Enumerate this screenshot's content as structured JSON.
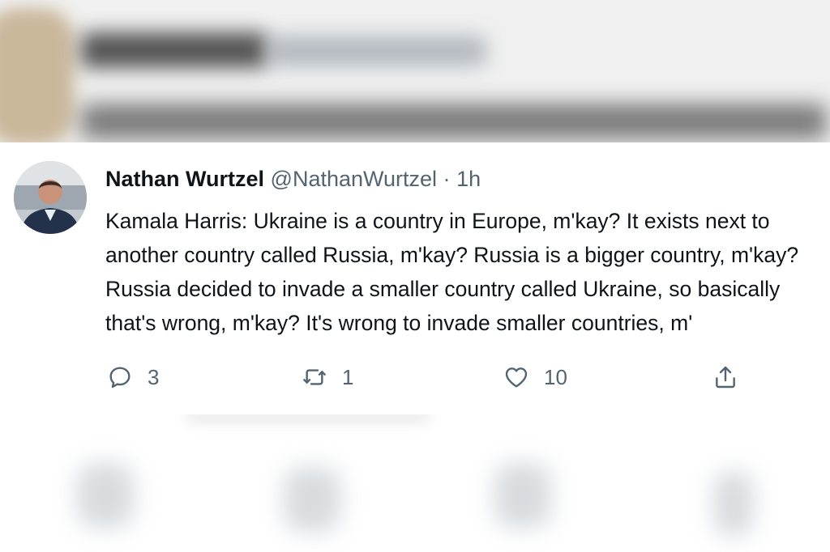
{
  "tweet": {
    "author_name": "Nathan Wurtzel",
    "handle": "@NathanWurtzel",
    "separator": "·",
    "time": "1h",
    "lines": [
      "Kamala Harris: Ukraine is a country in Europe, m'kay? It exists next to",
      "another country called Russia, m'kay? Russia is a bigger country, m'kay?",
      "Russia decided to invade a smaller country called Ukraine, so basically",
      "that's wrong, m'kay? It's wrong to invade smaller countries, m'"
    ]
  },
  "actions": {
    "reply": {
      "icon": "reply-icon",
      "count": "3"
    },
    "retweet": {
      "icon": "retweet-icon",
      "count": "1"
    },
    "like": {
      "icon": "heart-icon",
      "count": "10"
    },
    "share": {
      "icon": "share-icon"
    }
  },
  "colors": {
    "text": "#0f1419",
    "secondary": "#536471",
    "background": "#ffffff"
  }
}
